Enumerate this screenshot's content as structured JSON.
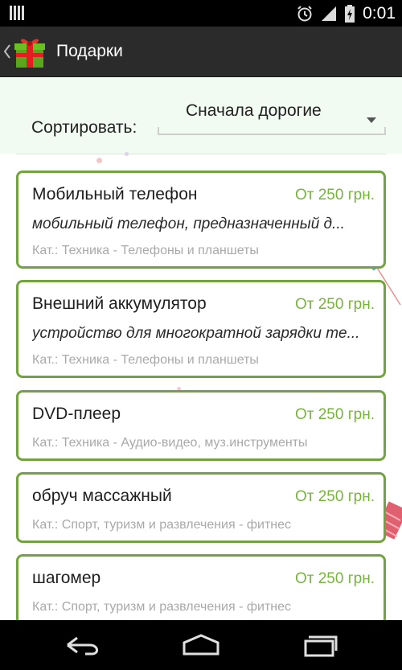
{
  "status_bar": {
    "time": "0:01",
    "icons": [
      "alarm-icon",
      "signal-icon",
      "battery-charging-icon"
    ]
  },
  "action_bar": {
    "title": "Подарки",
    "logo": "gift-box-icon",
    "back": "chevron-left-icon"
  },
  "sort": {
    "label": "Сортировать:",
    "selected": "Сначала дорогие"
  },
  "items": [
    {
      "title": "Мобильный телефон",
      "price": "От 250 грн.",
      "description": "мобильный телефон, предназначенный д...",
      "category": "Кат.: Техника - Телефоны и планшеты"
    },
    {
      "title": "Внешний аккумулятор",
      "price": "От 250 грн.",
      "description": "устройство для многократной зарядки те...",
      "category": "Кат.: Техника - Телефоны и планшеты"
    },
    {
      "title": "DVD-плеер",
      "price": "От 250 грн.",
      "category": "Кат.: Техника - Аудио-видео, муз.инструменты"
    },
    {
      "title": "обруч массажный",
      "price": "От 250 грн.",
      "category": "Кат.: Спорт, туризм и развлечения - фитнес"
    },
    {
      "title": "шагомер",
      "price": "От 250 грн.",
      "category": "Кат.: Спорт, туризм и развлечения - фитнес"
    }
  ],
  "nav_bar": {
    "buttons": [
      "back-nav-icon",
      "home-nav-icon",
      "recent-apps-icon"
    ]
  },
  "colors": {
    "accent_green": "#73a33f",
    "price_green": "#78b33e",
    "sort_panel_bg": "#f1fbf1",
    "action_bar_bg": "#2b2b2b"
  }
}
